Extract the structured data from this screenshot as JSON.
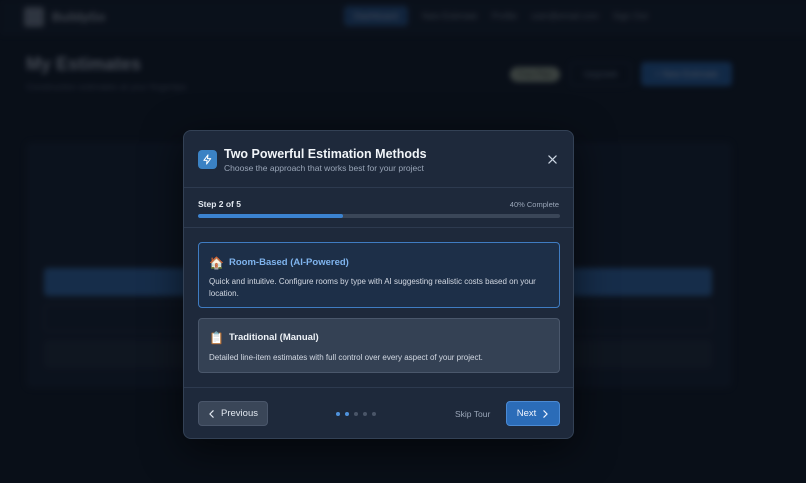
{
  "app": {
    "brand": "BuildyGo",
    "nav": {
      "dashboard": "Dashboard",
      "new_estimate": "New Estimate",
      "profile": "Profile",
      "email": "user@email.com",
      "sign_out": "Sign Out"
    },
    "page_title": "My Estimates",
    "page_subtitle": "Construction estimates at your fingertips",
    "badge": "Free Plan",
    "upgrade_label": "Upgrade",
    "new_estimate_label": "+ New Estimate"
  },
  "modal": {
    "title": "Two Powerful Estimation Methods",
    "subtitle": "Choose the approach that works best for your project",
    "step_label": "Step 2 of 5",
    "progress_label": "40% Complete",
    "progress_fraction": 0.4,
    "cards": [
      {
        "emoji": "🏠",
        "title": "Room-Based (AI-Powered)",
        "description": "Quick and intuitive. Configure rooms by type with AI suggesting realistic costs based on your location."
      },
      {
        "emoji": "📋",
        "title": "Traditional (Manual)",
        "description": "Detailed line-item estimates with full control over every aspect of your project."
      }
    ],
    "prev_label": "Previous",
    "skip_label": "Skip Tour",
    "next_label": "Next",
    "total_steps": 5,
    "current_step": 2
  },
  "colors": {
    "accent": "#3b82d0",
    "modal_bg": "#1e293b",
    "selected_card_border": "#3f7cc2"
  }
}
